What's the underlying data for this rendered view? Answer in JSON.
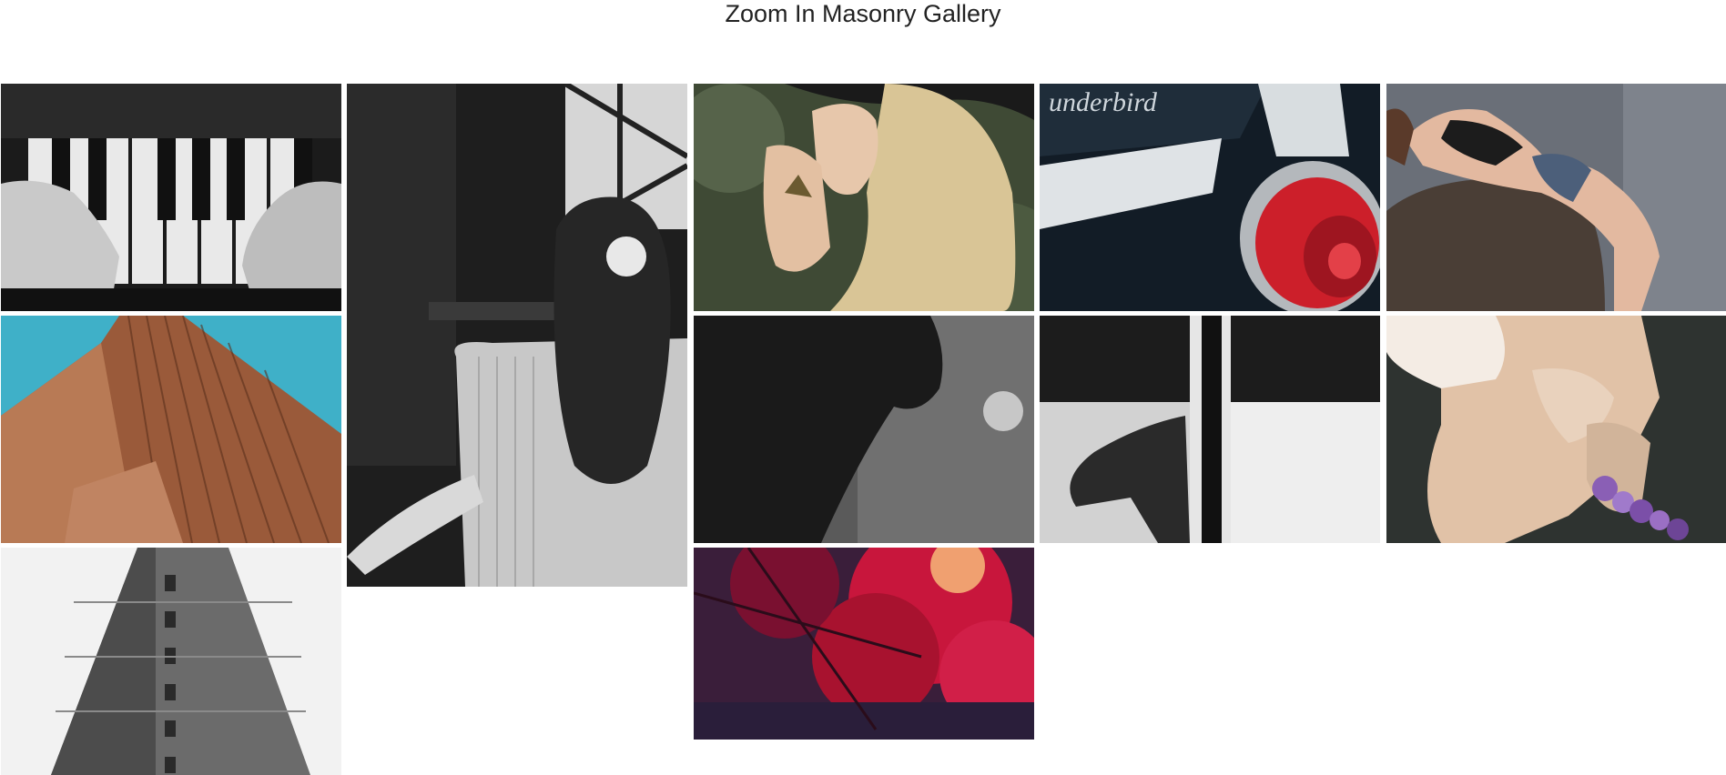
{
  "page": {
    "title": "Zoom In Masonry Gallery"
  },
  "gallery": {
    "items": [
      {
        "id": "piano",
        "subject": "piano-hands"
      },
      {
        "id": "woman-chair",
        "subject": "woman-back-chair"
      },
      {
        "id": "blonde",
        "subject": "blonde-woman-hat"
      },
      {
        "id": "car",
        "subject": "thunderbird-taillight",
        "caption": "underbird"
      },
      {
        "id": "rock",
        "subject": "woman-on-rock"
      },
      {
        "id": "skyscraper",
        "subject": "brown-skyscraper"
      },
      {
        "id": "silhouette",
        "subject": "woman-silhouette"
      },
      {
        "id": "architecture",
        "subject": "bw-architecture"
      },
      {
        "id": "flowers",
        "subject": "legs-flowers"
      },
      {
        "id": "flatiron",
        "subject": "flatiron-building"
      },
      {
        "id": "red-tree",
        "subject": "red-tree"
      }
    ]
  },
  "colors": {
    "background": "#ffffff",
    "title": "#222222",
    "sky": "#3fb0c8",
    "red_leaves": "#c8163c",
    "tail_light": "#cc1f2a"
  }
}
